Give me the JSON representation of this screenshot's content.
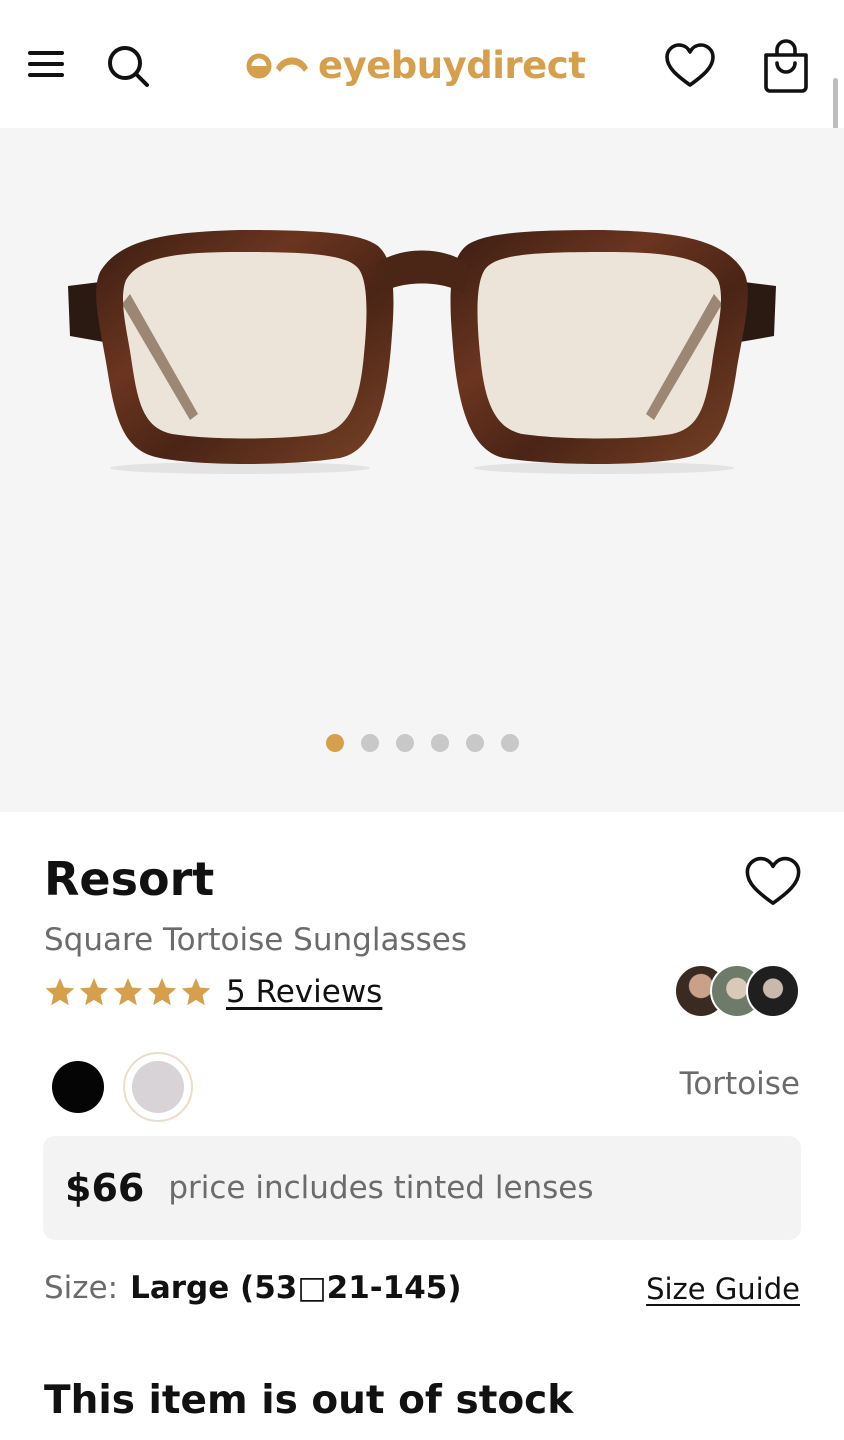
{
  "header": {
    "logo_text": "eyebuydirect",
    "menu_icon": "hamburger-icon",
    "search_icon": "search-icon",
    "favorites_icon": "heart-icon",
    "cart_icon": "shopping-bag-icon",
    "brand_color": "#d69f4c"
  },
  "gallery": {
    "image_count": 6,
    "active_index": 0
  },
  "product": {
    "name": "Resort",
    "subtitle": "Square Tortoise Sunglasses",
    "rating": 5,
    "reviews_label": "5 Reviews",
    "colors": [
      {
        "name": "Black",
        "hex": "#050505"
      },
      {
        "name": "Tortoise",
        "hex": "#d7d3d6",
        "selected": true
      }
    ],
    "selected_color_label": "Tortoise",
    "price": "$66",
    "price_note": "price includes tinted lenses",
    "size_label": "Size:",
    "size_value": "Large (53□21-145)",
    "size_guide_label": "Size Guide",
    "stock_status": "This item is out of stock"
  }
}
